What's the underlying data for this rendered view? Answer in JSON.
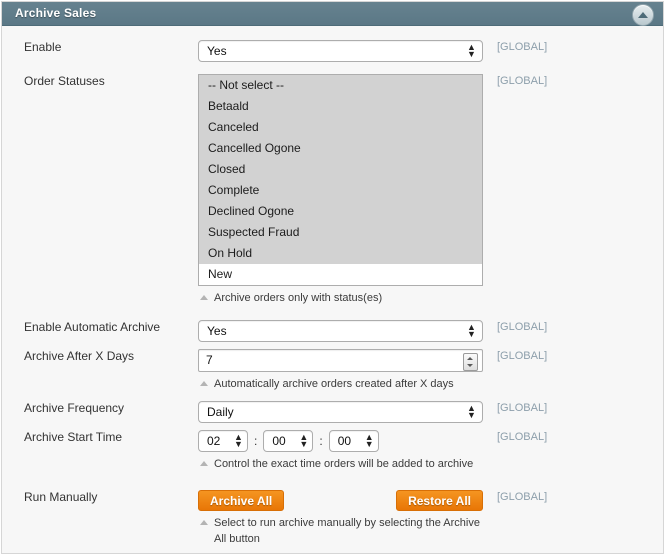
{
  "panel": {
    "title": "Archive Sales",
    "collapse_icon": "triangle-up-icon",
    "header_color": "#5f7d8c",
    "accent_color": "#e87606",
    "scope_color": "#8d9fab"
  },
  "scope_label": "[GLOBAL]",
  "fields": {
    "enable": {
      "label": "Enable",
      "value": "Yes",
      "scope": "[GLOBAL]"
    },
    "order_statuses": {
      "label": "Order Statuses",
      "options": [
        {
          "label": "-- Not select --",
          "selected": true
        },
        {
          "label": "Betaald",
          "selected": true
        },
        {
          "label": "Canceled",
          "selected": true
        },
        {
          "label": "Cancelled Ogone",
          "selected": true
        },
        {
          "label": "Closed",
          "selected": true
        },
        {
          "label": "Complete",
          "selected": true
        },
        {
          "label": "Declined Ogone",
          "selected": true
        },
        {
          "label": "Suspected Fraud",
          "selected": true
        },
        {
          "label": "On Hold",
          "selected": true
        },
        {
          "label": "New",
          "selected": false
        }
      ],
      "hint": "Archive orders only with status(es)",
      "scope": "[GLOBAL]"
    },
    "enable_automatic_archive": {
      "label": "Enable Automatic Archive",
      "value": "Yes",
      "scope": "[GLOBAL]"
    },
    "archive_after_x_days": {
      "label": "Archive After X Days",
      "value": "7",
      "hint": "Automatically archive orders created after X days",
      "scope": "[GLOBAL]"
    },
    "archive_frequency": {
      "label": "Archive Frequency",
      "value": "Daily",
      "scope": "[GLOBAL]"
    },
    "archive_start_time": {
      "label": "Archive Start Time",
      "hours": "02",
      "minutes": "00",
      "seconds": "00",
      "separator": ":",
      "hint": "Control the exact time orders will be added to archive",
      "scope": "[GLOBAL]"
    },
    "run_manually": {
      "label": "Run Manually",
      "archive_button": "Archive All",
      "restore_button": "Restore All",
      "hint": "Select to run archive manually by selecting the Archive All button",
      "scope": "[GLOBAL]"
    }
  }
}
